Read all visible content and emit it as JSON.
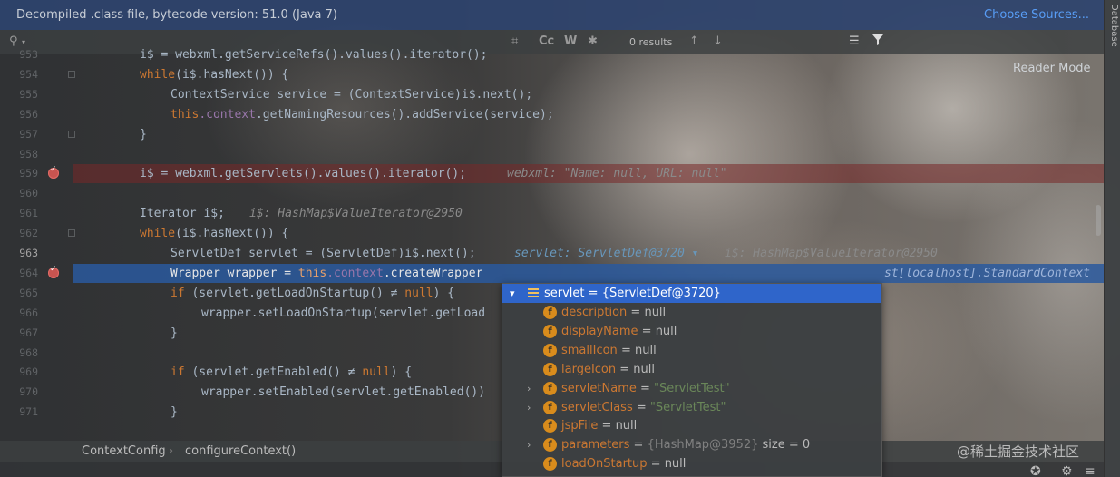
{
  "banner": {
    "text": "Decompiled .class file, bytecode version: 51.0 (Java 7)",
    "link": "Choose Sources..."
  },
  "search": {
    "results": "0 results",
    "icons": [
      "search-icon",
      "regex-icon",
      "match-case-icon",
      "words-icon",
      "prev-icon",
      "next-icon",
      "filter-lines-icon",
      "funnel-icon"
    ],
    "match_case": "Cc",
    "words": "W"
  },
  "sidebar": {
    "label": "Database"
  },
  "reader_mode": "Reader Mode",
  "lines": [
    {
      "no": "953",
      "code": "i$ = webxml.getServiceRefs().values().iterator();"
    },
    {
      "no": "954",
      "code": "while(i$.hasNext()) {"
    },
    {
      "no": "955",
      "code": "ContextService service = (ContextService)i$.next();"
    },
    {
      "no": "956",
      "code": "this.context.getNamingResources().addService(service);"
    },
    {
      "no": "957",
      "code": "}"
    },
    {
      "no": "958",
      "code": ""
    },
    {
      "no": "959",
      "code": "i$ = webxml.getServlets().values().iterator();",
      "hint": "webxml: \"Name: null, URL: null\""
    },
    {
      "no": "960",
      "code": ""
    },
    {
      "no": "961",
      "code": "Iterator i$;",
      "hint": "i$: HashMap$ValueIterator@2950"
    },
    {
      "no": "962",
      "code": "while(i$.hasNext()) {"
    },
    {
      "no": "963",
      "code": "ServletDef servlet = (ServletDef)i$.next();",
      "hint": "servlet: ServletDef@3720",
      "hint2": "i$: HashMap$ValueIterator@2950"
    },
    {
      "no": "964",
      "code": "Wrapper wrapper = this.context.createWrapper",
      "hint": "st[localhost].StandardContext"
    },
    {
      "no": "965",
      "code": "if (servlet.getLoadOnStartup() ≠ null) {"
    },
    {
      "no": "966",
      "code": "wrapper.setLoadOnStartup(servlet.getLoad"
    },
    {
      "no": "967",
      "code": "}"
    },
    {
      "no": "968",
      "code": ""
    },
    {
      "no": "969",
      "code": "if (servlet.getEnabled() ≠ null) {"
    },
    {
      "no": "970",
      "code": "wrapper.setEnabled(servlet.getEnabled())"
    },
    {
      "no": "971",
      "code": "}"
    }
  ],
  "breadcrumb": {
    "class": "ContextConfig",
    "method": "configureContext()"
  },
  "popup": {
    "root": {
      "name": "servlet",
      "value": "{ServletDef@3720}"
    },
    "fields": [
      {
        "name": "description",
        "value": "null"
      },
      {
        "name": "displayName",
        "value": "null"
      },
      {
        "name": "smallIcon",
        "value": "null"
      },
      {
        "name": "largeIcon",
        "value": "null"
      },
      {
        "name": "servletName",
        "value": "\"ServletTest\""
      },
      {
        "name": "servletClass",
        "value": "\"ServletTest\""
      },
      {
        "name": "jspFile",
        "value": "null"
      },
      {
        "name": "parameters",
        "value": "{HashMap@3952}",
        "extra": "size = 0"
      },
      {
        "name": "loadOnStartup",
        "value": "null"
      }
    ],
    "eq": "="
  },
  "watermark": "@稀土掘金技术社区",
  "colors": {
    "banner": "#2e436e",
    "selection": "#2a599e",
    "breakpoint": "#c75450",
    "keyword": "#cc7832",
    "field": "#9876aa"
  }
}
